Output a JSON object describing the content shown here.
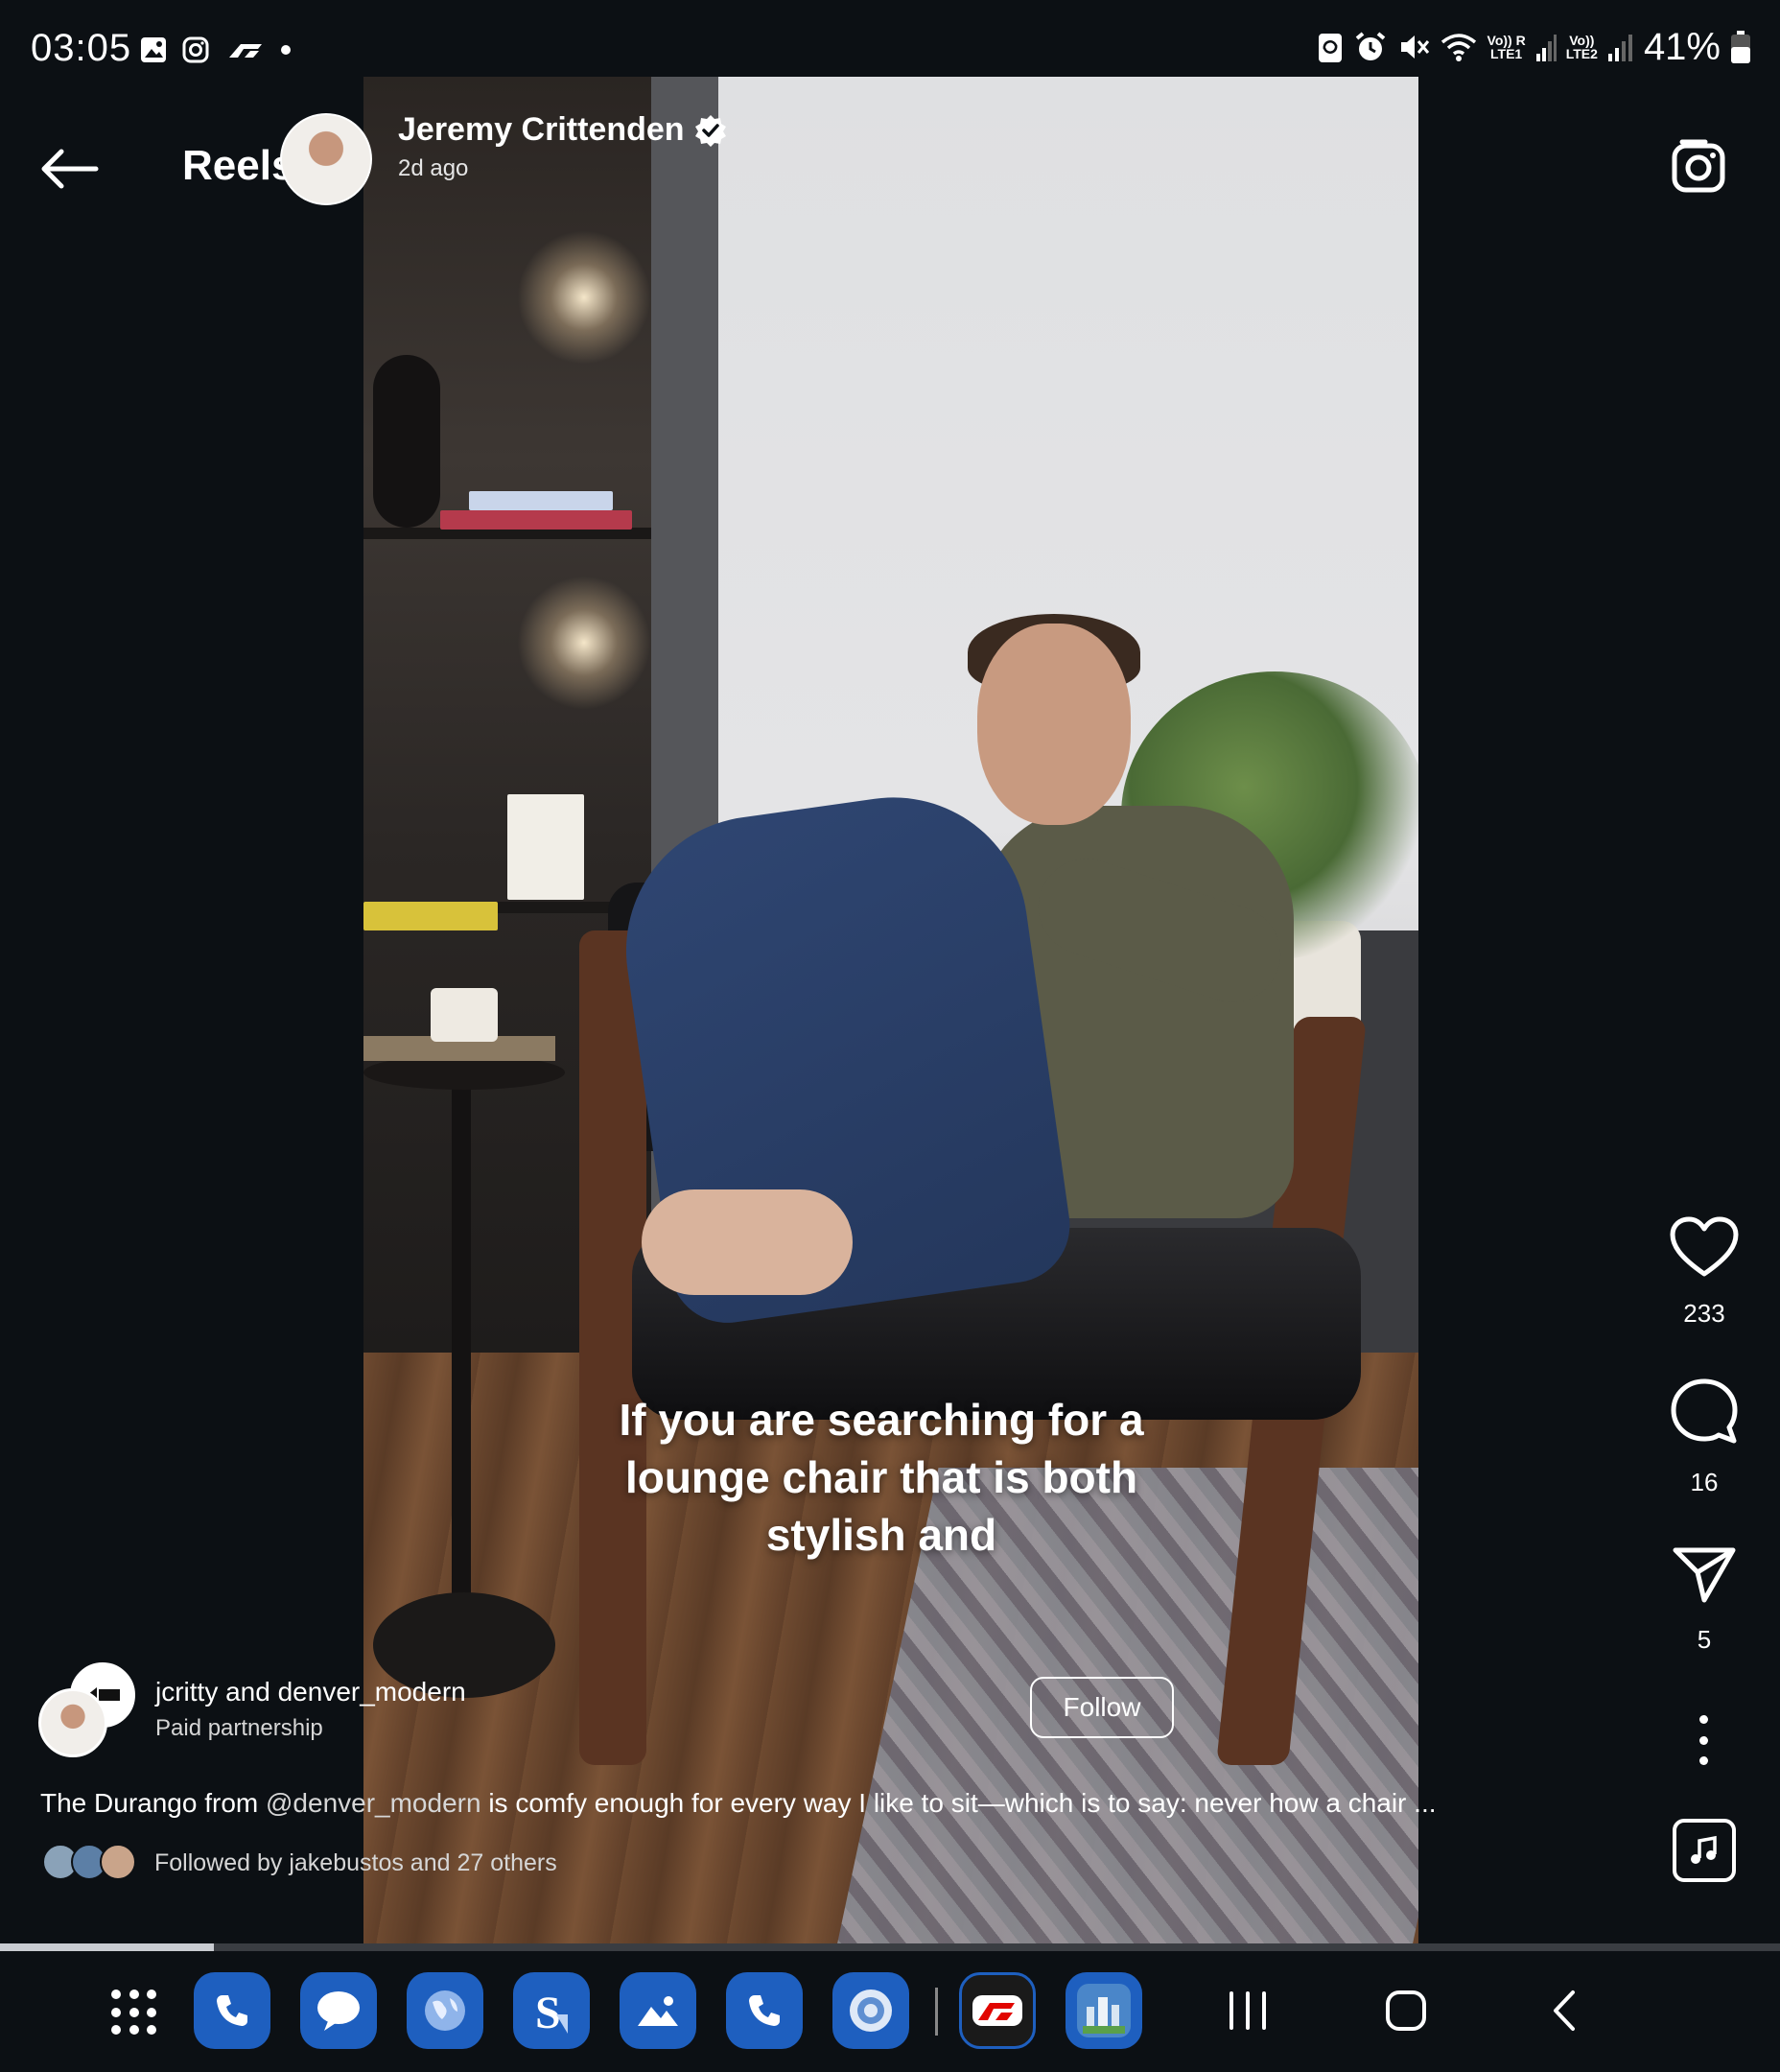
{
  "status_bar": {
    "time": "03:05",
    "battery": "41%",
    "sim1_label": "Vo)) R\nLTE1",
    "sim2_label": "Vo))\nLTE2",
    "icons": [
      "gallery-icon",
      "instagram-icon",
      "f1-icon",
      "dot-icon",
      "sync-icon",
      "alarm-icon",
      "mute-icon",
      "wifi-icon",
      "signal-icon",
      "battery-icon"
    ]
  },
  "header": {
    "title": "Reels",
    "author": "Jeremy Crittenden",
    "verified": true,
    "time_ago": "2d ago"
  },
  "video": {
    "caption": "If you are searching for a lounge chair that is both stylish and",
    "progress": 0.12
  },
  "actions": {
    "likes": "233",
    "comments": "16",
    "shares": "5"
  },
  "post": {
    "partners": "jcritty and denver_modern",
    "partnership_label": "Paid partnership",
    "follow_label": "Follow",
    "caption_prefix": "The Durango from ",
    "caption_mention": "@denver_modern",
    "caption_rest": " is comfy enough for every way I like to sit—which is to say: never how a chair ...",
    "followed_by": "Followed by jakebustos and 27 others"
  },
  "dock": {
    "apps": [
      "apps-grid-icon",
      "phone-icon",
      "messages-icon",
      "browser-icon",
      "simple-note-icon",
      "gallery-icon",
      "phone-icon",
      "camera-lens-icon",
      "f1-icon",
      "simcity-icon"
    ]
  },
  "nav": [
    "recents-icon",
    "home-icon",
    "back-icon"
  ],
  "colors": {
    "background": "#0c1014",
    "accent_blue": "#1e5fbf"
  }
}
